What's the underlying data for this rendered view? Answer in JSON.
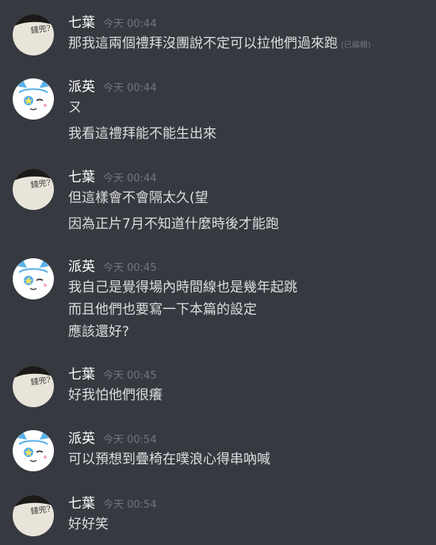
{
  "messages": [
    {
      "author": "七葉",
      "avatar": "calligraphy-avatar",
      "time": "今天 00:44",
      "lines": [
        "那我這兩個禮拜沒團說不定可以拉他們過來跑"
      ],
      "edited": "(已編輯)"
    },
    {
      "author": "派英",
      "avatar": "white-cat-avatar",
      "time": "今天 00:44",
      "lines": [
        "ㄡ",
        "我看這禮拜能不能生出來"
      ]
    },
    {
      "author": "七葉",
      "avatar": "calligraphy-avatar",
      "time": "今天 00:44",
      "lines": [
        "但這樣會不會隔太久(望",
        "因為正片7月不知道什麼時後才能跑"
      ]
    },
    {
      "author": "派英",
      "avatar": "white-cat-avatar",
      "time": "今天 00:45",
      "lines": [
        "我自己是覺得場內時間線也是幾年起跳",
        "而且他們也要寫一下本篇的設定",
        "應該還好?"
      ]
    },
    {
      "author": "七葉",
      "avatar": "calligraphy-avatar",
      "time": "今天 00:45",
      "lines": [
        "好我怕他們很癢"
      ]
    },
    {
      "author": "派英",
      "avatar": "white-cat-avatar",
      "time": "今天 00:54",
      "lines": [
        "可以預想到疊椅在噗浪心得串吶喊"
      ]
    },
    {
      "author": "七葉",
      "avatar": "calligraphy-avatar",
      "time": "今天 00:54",
      "lines": [
        "好好笑"
      ]
    }
  ],
  "avatar_text": "錢兜?"
}
